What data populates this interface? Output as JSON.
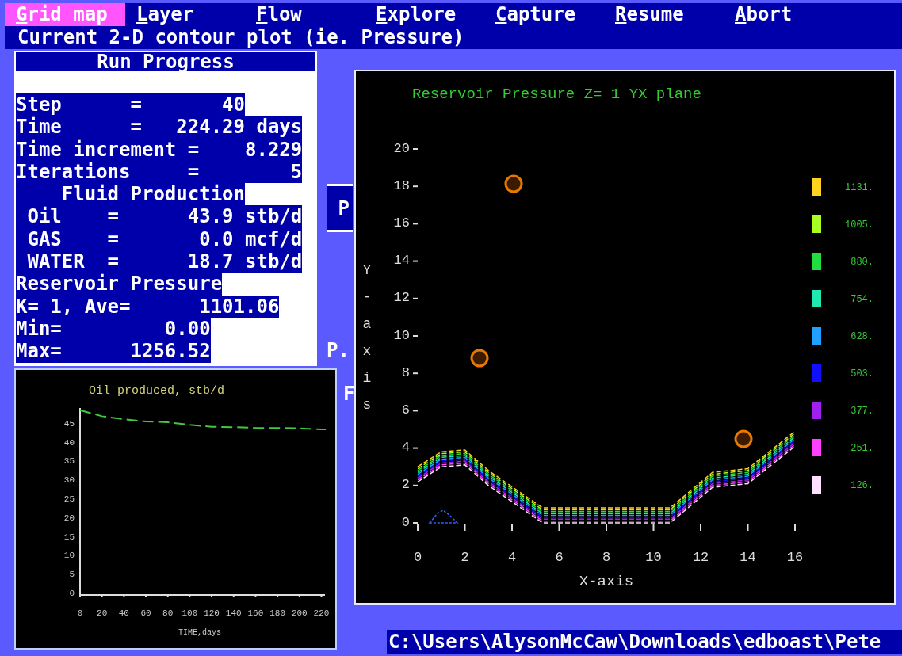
{
  "menu": [
    {
      "label": "Grid map",
      "selected": true
    },
    {
      "label": "Layer",
      "selected": false
    },
    {
      "label": "Flow",
      "selected": false
    },
    {
      "label": "Explore",
      "selected": false
    },
    {
      "label": "Capture",
      "selected": false
    },
    {
      "label": "Resume",
      "selected": false
    },
    {
      "label": "Abort",
      "selected": false
    }
  ],
  "prompt": "Current 2-D contour plot (ie. Pressure)",
  "run_progress": {
    "title": "Run Progress",
    "lines": [
      "Step      =       40",
      "Time      =   224.29 days",
      "Time increment =    8.229",
      "Iterations     =        5",
      "    Fluid Production",
      " Oil    =      43.9 stb/d",
      " GAS    =       0.0 mcf/d",
      " WATER  =      18.7 stb/d",
      "Reservoir Pressure",
      "K= 1, Ave=      1101.06",
      "Min=         0.00",
      "Max=      1256.52"
    ]
  },
  "obscured_fragments": [
    "P",
    "P.",
    "F"
  ],
  "oil_chart": {
    "chart_data": {
      "type": "line",
      "title": "Oil produced, stb/d",
      "xlabel": "TIME,days",
      "x": [
        0,
        20,
        40,
        60,
        80,
        100,
        120,
        140,
        160,
        180,
        200,
        220,
        224
      ],
      "series": [
        {
          "color": "#40c840",
          "line_style": "dashed",
          "values": [
            49,
            47.4,
            46.6,
            46.0,
            45.8,
            45.1,
            44.6,
            44.5,
            44.3,
            44.3,
            44.2,
            43.9,
            43.9
          ]
        }
      ],
      "xlim": [
        0,
        224
      ],
      "ylim": [
        0,
        50
      ],
      "xticks": [
        0,
        20,
        40,
        60,
        80,
        100,
        120,
        140,
        160,
        180,
        200,
        220
      ],
      "yticks": [
        0,
        5,
        10,
        15,
        20,
        25,
        30,
        35,
        40,
        45
      ]
    }
  },
  "contour_plot": {
    "chart_data": {
      "type": "line",
      "title": "Reservoir Pressure Z= 1 YX plane",
      "xlabel": "X-axis",
      "ylabel": "Y-axis",
      "x": [
        0,
        1,
        2,
        3,
        5.3,
        10.7,
        12.5,
        14,
        16
      ],
      "series": [
        {
          "name": "1131.",
          "color": "#ffd21f",
          "line_style": "dashed",
          "values": [
            3.0,
            3.8,
            3.9,
            2.8,
            0.8,
            0.8,
            2.7,
            2.9,
            4.9
          ]
        },
        {
          "name": "1005.",
          "color": "#a8ff20",
          "line_style": "dashed",
          "values": [
            2.9,
            3.7,
            3.8,
            2.7,
            0.7,
            0.7,
            2.6,
            2.8,
            4.8
          ]
        },
        {
          "name": "880.",
          "color": "#20e040",
          "line_style": "dashed",
          "values": [
            2.8,
            3.6,
            3.7,
            2.6,
            0.6,
            0.6,
            2.5,
            2.7,
            4.7
          ]
        },
        {
          "name": "754.",
          "color": "#20e8b0",
          "line_style": "dashed",
          "values": [
            2.7,
            3.5,
            3.6,
            2.5,
            0.5,
            0.5,
            2.4,
            2.6,
            4.6
          ]
        },
        {
          "name": "628.",
          "color": "#20a0ff",
          "line_style": "dashed",
          "values": [
            2.6,
            3.4,
            3.5,
            2.4,
            0.4,
            0.4,
            2.3,
            2.5,
            4.5
          ]
        },
        {
          "name": "503.",
          "color": "#1010ff",
          "line_style": "dashed",
          "values": [
            2.5,
            3.3,
            3.4,
            2.3,
            0.3,
            0.3,
            2.2,
            2.4,
            4.4
          ]
        },
        {
          "name": "377.",
          "color": "#a020f0",
          "line_style": "dashed",
          "values": [
            2.4,
            3.2,
            3.3,
            2.2,
            0.2,
            0.2,
            2.1,
            2.3,
            4.3
          ]
        },
        {
          "name": "251.",
          "color": "#ff40ff",
          "line_style": "dashed",
          "values": [
            2.3,
            3.1,
            3.2,
            2.1,
            0.1,
            0.1,
            2.0,
            2.2,
            4.2
          ]
        },
        {
          "name": "126.",
          "color": "#ffe0ff",
          "line_style": "dashed",
          "values": [
            2.2,
            3.0,
            3.1,
            2.0,
            0.0,
            0.0,
            1.9,
            2.1,
            4.1
          ]
        }
      ],
      "xlim": [
        0,
        16
      ],
      "ylim": [
        0,
        20
      ],
      "xticks": [
        0,
        2,
        4,
        6,
        8,
        10,
        12,
        14,
        16
      ],
      "yticks": [
        0,
        2,
        4,
        6,
        8,
        10,
        12,
        14,
        16,
        18,
        20
      ]
    }
  },
  "status_bar": "C:\\Users\\AlysonMcCaw\\Downloads\\edboast\\Pete"
}
